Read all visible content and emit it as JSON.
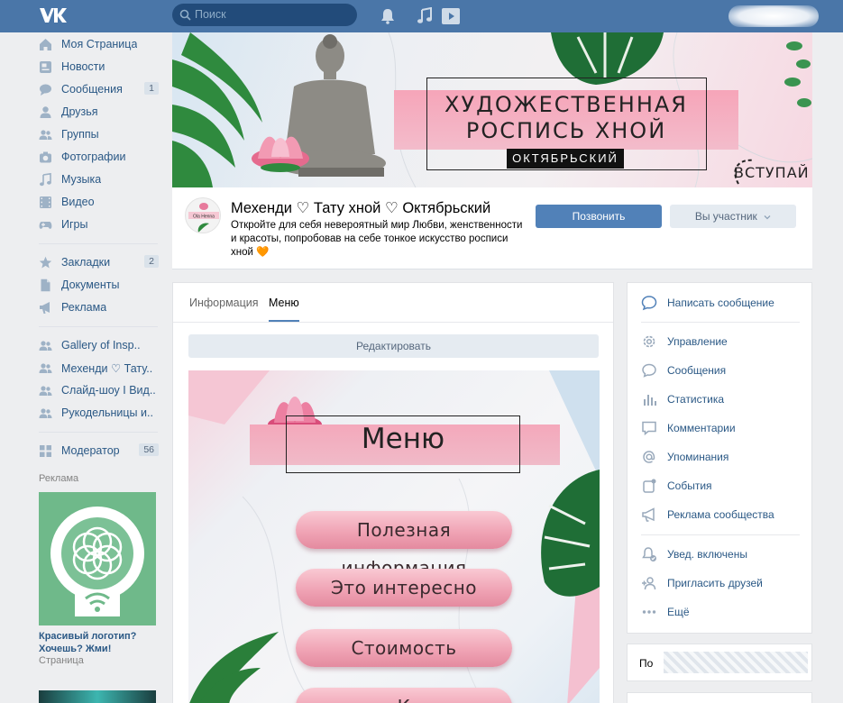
{
  "header": {
    "logo": "VK",
    "search_placeholder": "Поиск",
    "icons": [
      "vk-logo-icon",
      "search-icon",
      "bell-icon",
      "music-icon",
      "play-icon"
    ]
  },
  "sidebar": {
    "items": [
      {
        "label": "Моя Страница",
        "icon": "home-icon"
      },
      {
        "label": "Новости",
        "icon": "news-icon"
      },
      {
        "label": "Сообщения",
        "icon": "messages-icon",
        "count": "1"
      },
      {
        "label": "Друзья",
        "icon": "friend-icon"
      },
      {
        "label": "Группы",
        "icon": "groups-icon"
      },
      {
        "label": "Фотографии",
        "icon": "camera-icon"
      },
      {
        "label": "Музыка",
        "icon": "music-icon"
      },
      {
        "label": "Видео",
        "icon": "video-icon"
      },
      {
        "label": "Игры",
        "icon": "gamepad-icon"
      }
    ],
    "items2": [
      {
        "label": "Закладки",
        "icon": "star-icon",
        "count": "2"
      },
      {
        "label": "Документы",
        "icon": "document-icon"
      },
      {
        "label": "Реклама",
        "icon": "megaphone-icon"
      }
    ],
    "groups": [
      {
        "label": "Gallery of Insp.."
      },
      {
        "label": "Мехенди ♡ Тату.."
      },
      {
        "label": "Слайд-шоу I Вид.."
      },
      {
        "label": "Рукодельницы и.."
      }
    ],
    "moderator": {
      "label": "Модератор",
      "count": "56"
    },
    "ad": {
      "heading": "Реклама",
      "title": "Красивый логотип? Хочешь? Жми!",
      "type": "Страница"
    }
  },
  "cover": {
    "title": "ХУДОЖЕСТВЕННАЯ РОСПИСЬ ХНОЙ",
    "tag": "ОКТЯБРЬСКИЙ",
    "join": "ВСТУПАЙ"
  },
  "group": {
    "name": "Мехенди ♡ Тату хной ♡ Октябрьский",
    "description": "Откройте для себя невероятный мир Любви, женственности и красоты, попробовав на себе тонкое искусство росписи хной 🧡",
    "avatar_text": "Ola Henna",
    "call_button": "Позвонить",
    "member_button": "Вы участник"
  },
  "content": {
    "tabs": [
      {
        "label": "Информация",
        "active": false
      },
      {
        "label": "Меню",
        "active": true
      }
    ],
    "edit_button": "Редактировать",
    "menu_title": "Меню",
    "menu_buttons": [
      "Полезная информация",
      "Это интересно",
      "Стоимость",
      "К"
    ]
  },
  "right_menu": {
    "write": "Написать сообщение",
    "items": [
      {
        "label": "Управление",
        "icon": "gear-icon"
      },
      {
        "label": "Сообщения",
        "icon": "chat-icon"
      },
      {
        "label": "Статистика",
        "icon": "stats-icon"
      },
      {
        "label": "Комментарии",
        "icon": "comment-icon"
      },
      {
        "label": "Упоминания",
        "icon": "at-icon"
      },
      {
        "label": "События",
        "icon": "event-icon"
      },
      {
        "label": "Реклама сообщества",
        "icon": "megaphone-icon"
      }
    ],
    "items2": [
      {
        "label": "Увед. включены",
        "icon": "bell-check-icon"
      },
      {
        "label": "Пригласить друзей",
        "icon": "add-friend-icon"
      },
      {
        "label": "Ещё",
        "icon": "more-icon"
      }
    ]
  },
  "right_box2": {
    "label": "По"
  },
  "colors": {
    "header_bg": "#4a76a8",
    "link": "#2a5885",
    "primary_button": "#5181b8",
    "page_bg": "#edeef0"
  }
}
